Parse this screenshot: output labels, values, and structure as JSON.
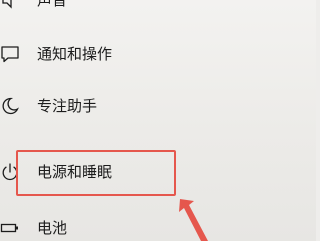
{
  "nav": {
    "items": [
      {
        "label": "声音",
        "icon": "speaker-icon"
      },
      {
        "label": "通知和操作",
        "icon": "notification-icon"
      },
      {
        "label": "专注助手",
        "icon": "moon-icon"
      },
      {
        "label": "电源和睡眠",
        "icon": "power-icon",
        "highlighted": true
      },
      {
        "label": "电池",
        "icon": "battery-icon"
      }
    ]
  },
  "annotation": {
    "highlight_color": "#e5574d",
    "arrow_color": "#e5574d"
  }
}
